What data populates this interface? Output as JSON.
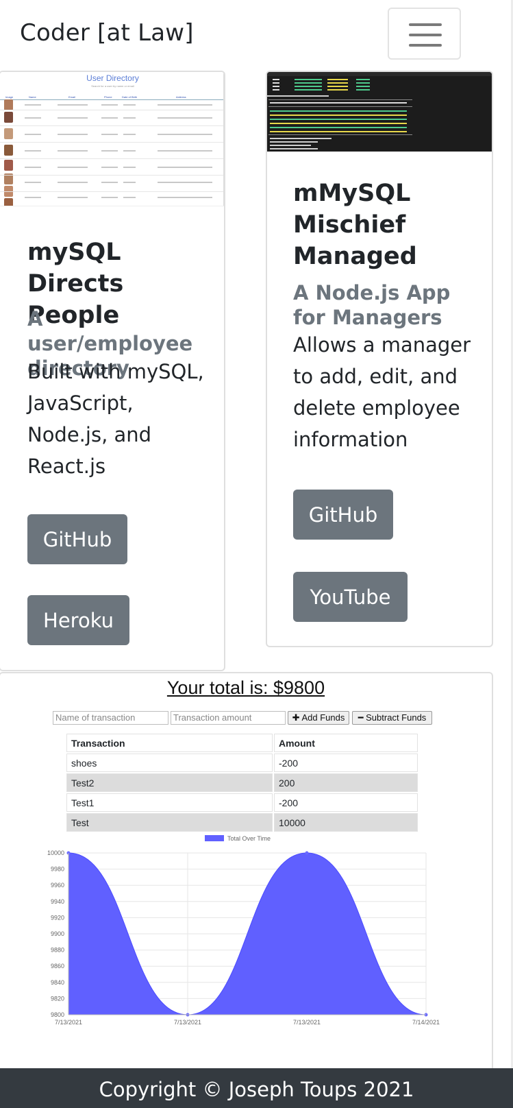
{
  "navbar": {
    "brand": "Coder [at Law]",
    "toggler_icon": "hamburger-icon"
  },
  "projects": [
    {
      "image_name": "user-directory-screenshot",
      "image_text": {
        "title": "User Directory",
        "subtitle": "Search for a user by name or email",
        "columns": [
          "Image",
          "Name",
          "Email",
          "Phone",
          "Date of Birth",
          "Address"
        ]
      },
      "title": "mySQL Directs People",
      "subtitle": "A user/employee directory",
      "text": "Built with mySQL, JavaScript, Node.js, and React.js",
      "buttons": [
        "GitHub",
        "Heroku"
      ]
    },
    {
      "image_name": "terminal-screenshot",
      "title": "mMySQL Mischief Managed",
      "subtitle": "A Node.js App for Managers",
      "text": "Allows a manager to add, edit, and delete employee information",
      "buttons": [
        "GitHub",
        "YouTube"
      ]
    }
  ],
  "budget": {
    "total_label": "Your total is: $9800",
    "name_placeholder": "Name of transaction",
    "amount_placeholder": "Transaction amount",
    "add_label": "Add Funds",
    "subtract_label": "Subtract Funds",
    "table": {
      "headers": [
        "Transaction",
        "Amount"
      ],
      "rows": [
        [
          "shoes",
          "-200"
        ],
        [
          "Test2",
          "200"
        ],
        [
          "Test1",
          "-200"
        ],
        [
          "Test",
          "10000"
        ]
      ]
    }
  },
  "chart_data": {
    "type": "area",
    "title": "",
    "legend": [
      "Total Over Time"
    ],
    "legend_position": "top",
    "categories": [
      "7/13/2021",
      "7/13/2021",
      "7/13/2021",
      "7/14/2021"
    ],
    "series": [
      {
        "name": "Total Over Time",
        "values": [
          10000,
          9800,
          10000,
          9800
        ]
      }
    ],
    "y_ticks": [
      9800,
      9820,
      9840,
      9860,
      9880,
      9900,
      9920,
      9940,
      9960,
      9980,
      10000
    ],
    "ylim": [
      9800,
      10000
    ],
    "grid": true,
    "color": "#6060ff"
  },
  "footer": {
    "text": "Copyright © Joseph Toups 2021"
  }
}
